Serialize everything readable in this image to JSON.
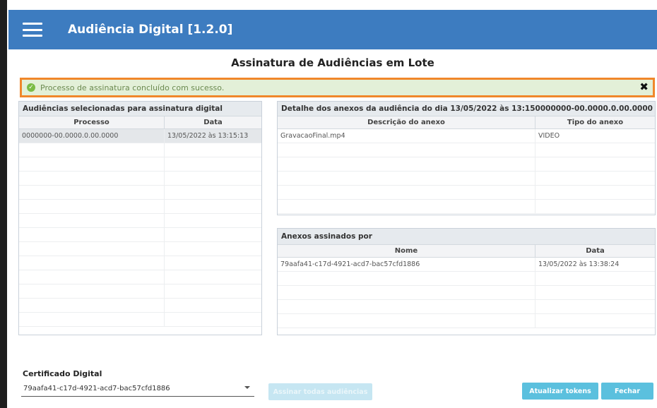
{
  "app": {
    "title": "Audiência Digital [1.2.0]"
  },
  "page": {
    "title": "Assinatura de Audiências em Lote"
  },
  "alert": {
    "message": "Processo de assinatura concluído com sucesso.",
    "close": "✖"
  },
  "selected_panel": {
    "title": "Audiências selecionadas para assinatura digital",
    "columns": [
      "Processo",
      "Data"
    ],
    "rows": [
      {
        "processo": "0000000-00.0000.0.00.0000",
        "data": "13/05/2022 às 13:15:13"
      }
    ]
  },
  "detail_panel": {
    "title": "Detalhe dos anexos da audiência do dia  13/05/2022 às 13:15",
    "process_number": "0000000-00.0000.0.00.0000",
    "columns": [
      "Descrição do anexo",
      "Tipo do anexo"
    ],
    "rows": [
      {
        "descricao": "GravacaoFinal.mp4",
        "tipo": "VIDEO"
      }
    ]
  },
  "signed_panel": {
    "title": "Anexos assinados por",
    "columns": [
      "Nome",
      "Data"
    ],
    "rows": [
      {
        "nome": "79aafa41-c17d-4921-acd7-bac57cfd1886",
        "data": "13/05/2022 às 13:38:24"
      }
    ]
  },
  "certificate": {
    "label": "Certificado Digital",
    "value": "79aafa41-c17d-4921-acd7-bac57cfd1886"
  },
  "buttons": {
    "sign_all": "Assinar todas audiências",
    "refresh_tokens": "Atualizar tokens",
    "close": "Fechar"
  },
  "colors": {
    "header": "#3d7cc0",
    "alert_border": "#f0872a",
    "alert_bg": "#e3f0d8",
    "button": "#5bc0de"
  }
}
